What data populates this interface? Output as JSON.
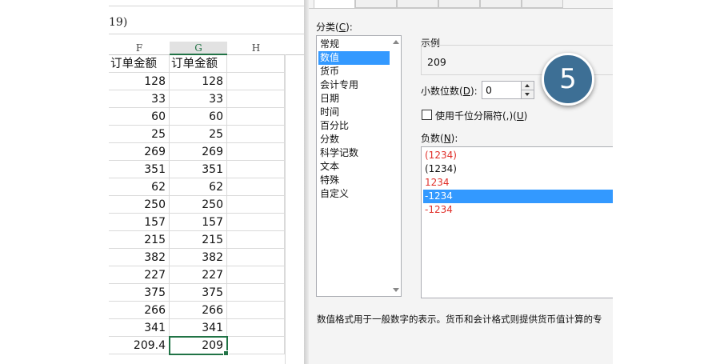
{
  "sheet": {
    "formula_fragment": "19)",
    "columns": [
      "F",
      "G",
      "H"
    ],
    "selected_column": "G",
    "col_f_values": [
      "订单金额",
      "128",
      "33",
      "60",
      "25",
      "269",
      "351",
      "62",
      "250",
      "157",
      "215",
      "382",
      "227",
      "375",
      "266",
      "341",
      "209.4"
    ],
    "col_g_values": [
      "订单金额",
      "128",
      "33",
      "60",
      "25",
      "269",
      "351",
      "62",
      "250",
      "157",
      "215",
      "382",
      "227",
      "375",
      "266",
      "341",
      "209"
    ]
  },
  "dialog": {
    "category_label": "分类(",
    "category_key": "C",
    "category_suffix": "):",
    "categories": [
      "常规",
      "数值",
      "货币",
      "会计专用",
      "日期",
      "时间",
      "百分比",
      "分数",
      "科学记数",
      "文本",
      "特殊",
      "自定义"
    ],
    "selected_category": "数值",
    "sample_label": "示例",
    "sample_value": "209",
    "decimal_label": "小数位数(",
    "decimal_key": "D",
    "decimal_suffix": "):",
    "decimal_value": "0",
    "thousands_label": "使用千位分隔符(,)(",
    "thousands_key": "U",
    "thousands_suffix": ")",
    "thousands_checked": false,
    "negative_label": "负数(",
    "negative_key": "N",
    "negative_suffix": "):",
    "negative_formats": [
      {
        "text": "(1234)",
        "color": "#e0302a"
      },
      {
        "text": "(1234)",
        "color": "#111111"
      },
      {
        "text": "1234",
        "color": "#e0302a"
      },
      {
        "text": "-1234",
        "color": "#ffffff"
      },
      {
        "text": "-1234",
        "color": "#e0302a"
      }
    ],
    "selected_negative_index": 3,
    "description": "数值格式用于一般数字的表示。货币和会计格式则提供货币值计算的专"
  },
  "badge": {
    "step": "5"
  },
  "colors": {
    "accent_green": "#217346",
    "selection_blue": "#3399ff",
    "badge_blue": "#3d6f95",
    "negative_red": "#e0302a"
  }
}
